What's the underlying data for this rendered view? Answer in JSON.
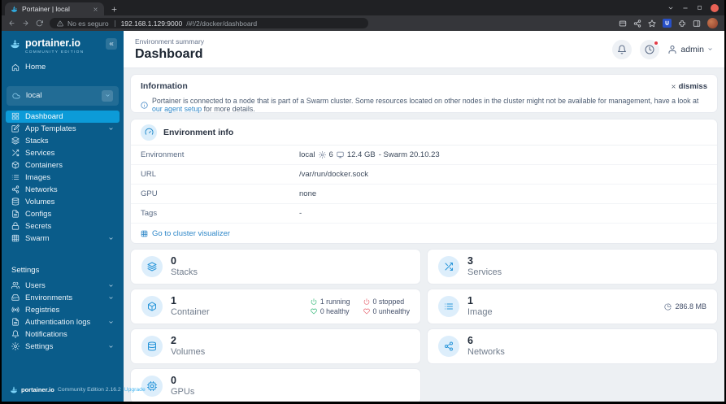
{
  "browser": {
    "tab_title": "Portainer | local",
    "security_warning": "No es seguro",
    "url_host": "192.168.1.129:9000",
    "url_path": "/#!/2/docker/dashboard"
  },
  "sidebar": {
    "brand": "portainer.io",
    "edition": "COMMUNITY EDITION",
    "home_label": "Home",
    "environment_name": "local",
    "menu": [
      {
        "label": "Dashboard",
        "icon": "grid"
      },
      {
        "label": "App Templates",
        "icon": "edit",
        "expandable": true
      },
      {
        "label": "Stacks",
        "icon": "layers"
      },
      {
        "label": "Services",
        "icon": "shuffle"
      },
      {
        "label": "Containers",
        "icon": "box"
      },
      {
        "label": "Images",
        "icon": "list"
      },
      {
        "label": "Networks",
        "icon": "share"
      },
      {
        "label": "Volumes",
        "icon": "database"
      },
      {
        "label": "Configs",
        "icon": "file"
      },
      {
        "label": "Secrets",
        "icon": "lock"
      },
      {
        "label": "Swarm",
        "icon": "grid3",
        "expandable": true
      }
    ],
    "settings_heading": "Settings",
    "settings_menu": [
      {
        "label": "Users",
        "icon": "users",
        "expandable": true
      },
      {
        "label": "Environments",
        "icon": "hard-drive",
        "expandable": true
      },
      {
        "label": "Registries",
        "icon": "radio"
      },
      {
        "label": "Authentication logs",
        "icon": "file",
        "expandable": true
      },
      {
        "label": "Notifications",
        "icon": "bell"
      },
      {
        "label": "Settings",
        "icon": "gear",
        "expandable": true
      }
    ],
    "footer_brand": "portainer.io",
    "footer_edition": "Community Edition 2.16.2",
    "footer_upgrade": "Upgrade"
  },
  "header": {
    "breadcrumb": "Environment summary",
    "title": "Dashboard",
    "user": "admin"
  },
  "banner": {
    "title": "Information",
    "dismiss": "dismiss",
    "message_start": "Portainer is connected to a node that is part of a Swarm cluster. Some resources located on other nodes in the cluster might not be available for management, have a look at",
    "message_link": "our agent setup",
    "message_end": "for more details."
  },
  "environment_info": {
    "title": "Environment info",
    "labels": {
      "environment": "Environment",
      "url": "URL",
      "gpu": "GPU",
      "tags": "Tags"
    },
    "values": {
      "environment_name": "local",
      "cpu_count": "6",
      "memory": "12.4 GB",
      "swarm_version": "- Swarm 20.10.23",
      "url": "/var/run/docker.sock",
      "gpu": "none",
      "tags": "-"
    },
    "cluster_link": "Go to cluster visualizer"
  },
  "tiles": {
    "stacks": {
      "count": "0",
      "label": "Stacks"
    },
    "services": {
      "count": "3",
      "label": "Services"
    },
    "container": {
      "count": "1",
      "label": "Container",
      "running": "1 running",
      "stopped": "0 stopped",
      "healthy": "0 healthy",
      "unhealthy": "0 unhealthy"
    },
    "image": {
      "count": "1",
      "label": "Image",
      "size": "286.8 MB"
    },
    "volumes": {
      "count": "2",
      "label": "Volumes"
    },
    "networks": {
      "count": "6",
      "label": "Networks"
    },
    "gpus": {
      "count": "0",
      "label": "GPUs"
    }
  },
  "colors": {
    "accent": "#0086c9",
    "sidebar_background": "#0a5c8a",
    "active_item": "#0c9bd8",
    "link": "#2e87c8",
    "success": "#2bb573",
    "danger": "#e5606c"
  }
}
